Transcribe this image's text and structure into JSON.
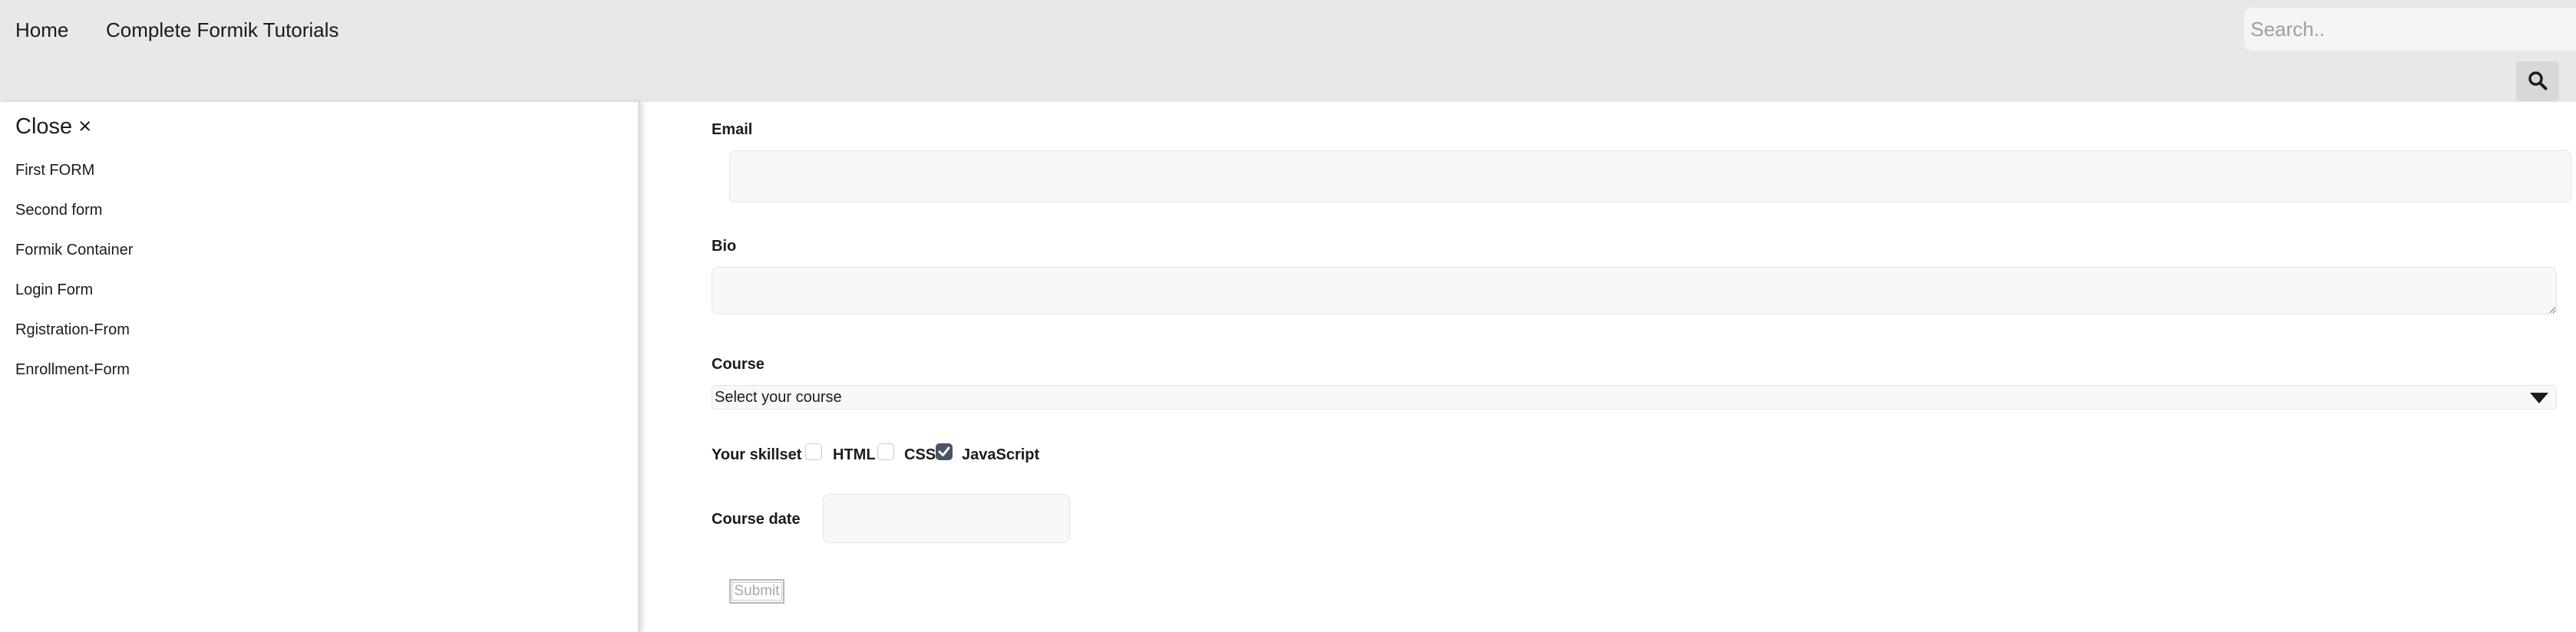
{
  "topnav": {
    "home": "Home",
    "tutorials": "Complete Formik Tutorials",
    "search_placeholder": "Search..",
    "search_icon": "magnifier-icon"
  },
  "sidebar": {
    "close_label": "Close ×",
    "items": [
      {
        "label": "First FORM"
      },
      {
        "label": "Second form"
      },
      {
        "label": "Formik Container"
      },
      {
        "label": "Login Form"
      },
      {
        "label": "Rgistration-From"
      },
      {
        "label": "Enrollment-Form"
      }
    ]
  },
  "form": {
    "email_label": "Email",
    "email_value": "",
    "bio_label": "Bio",
    "bio_value": "",
    "course_label": "Course",
    "course_selected": "Select your course",
    "skillset_label": "Your skillset",
    "skills": [
      {
        "label": "HTML",
        "checked": false
      },
      {
        "label": "CSS",
        "checked": false
      },
      {
        "label": "JavaScript",
        "checked": true
      }
    ],
    "date_label": "Course date",
    "date_value": "",
    "submit_label": "Submit"
  },
  "colors": {
    "topbar_bg": "#e8e8e8",
    "field_bg": "#f7f8f9",
    "checkbox_checked": "#4a5568"
  }
}
